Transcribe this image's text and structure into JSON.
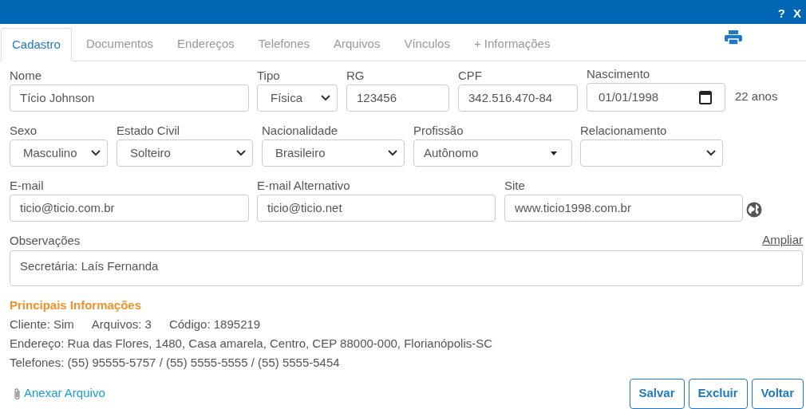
{
  "title_bar": {
    "buttons": [
      "?",
      "X"
    ]
  },
  "tabs": [
    {
      "label": "Cadastro",
      "selected": true
    },
    {
      "label": "Documentos",
      "selected": false
    },
    {
      "label": "Endereços",
      "selected": false
    },
    {
      "label": "Telefones",
      "selected": false
    },
    {
      "label": "Arquivos",
      "selected": false
    },
    {
      "label": "Vínculos",
      "selected": false
    },
    {
      "label": "+ Informações",
      "selected": false
    }
  ],
  "form_rows": [
    {
      "fields": [
        {
          "label": "Nome",
          "kind": "text",
          "value": "Tício Johnson"
        },
        {
          "label": "Tipo",
          "kind": "select",
          "value": "Física"
        },
        {
          "label": "RG",
          "kind": "text",
          "value": "123456"
        },
        {
          "label": "CPF",
          "kind": "text",
          "value": "342.516.470-84"
        },
        {
          "label": "Nascimento",
          "kind": "date",
          "value": "01/01/1998"
        }
      ],
      "suffix": "22 anos"
    },
    {
      "fields": [
        {
          "label": "Sexo",
          "kind": "select",
          "value": "Masculino"
        },
        {
          "label": "Estado Civil",
          "kind": "select",
          "value": "Solteiro"
        },
        {
          "label": "Nacionalidade",
          "kind": "select",
          "value": "Brasileiro"
        },
        {
          "label": "Profissão",
          "kind": "dropdown",
          "value": "Autônomo"
        },
        {
          "label": "Relacionamento",
          "kind": "select"
        }
      ]
    },
    {
      "fields": [
        {
          "label": "E-mail",
          "kind": "text",
          "value": "ticio@ticio.com.br"
        },
        {
          "label": "E-mail Alternativo",
          "kind": "text",
          "value": "ticio@ticio.net"
        },
        {
          "label": "Site",
          "kind": "text",
          "value": "www.ticio1998.com.br"
        }
      ],
      "link_button": true
    }
  ],
  "observacoes": {
    "label": "Observações",
    "link": "Ampliar",
    "value": "Secretária: Laís Fernanda"
  },
  "summary": {
    "title": "Principais Informações",
    "items": [
      "Cliente: Sim",
      "Arquivos: 3",
      "Código: 1895219"
    ],
    "lines": [
      "Endereço: Rua das Flores, 1480, Casa amarela, Centro, CEP 88000-000, Florianópolis-SC",
      "Telefones: (55) 95555-5757 / (55) 5555-5555 / (55) 5555-5454"
    ]
  },
  "attach_link": "Anexar Arquivo",
  "buttons": [
    "Salvar",
    "Excluir",
    "Voltar"
  ]
}
